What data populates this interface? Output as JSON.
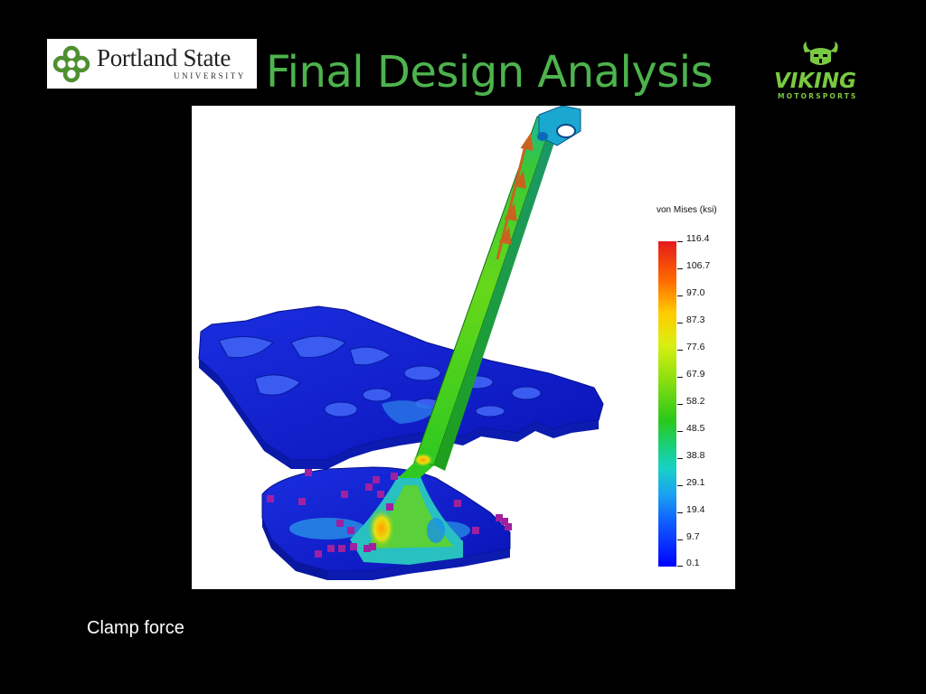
{
  "header": {
    "logo_name": "Portland State",
    "logo_subtitle": "UNIVERSITY",
    "title": "Final Design Analysis",
    "brand_word": "VIKING",
    "brand_sub": "MOTORSPORTS"
  },
  "legend": {
    "title": "von Mises (ksi)",
    "values": [
      "116.4",
      "106.7",
      "97.0",
      "87.3",
      "77.6",
      "67.9",
      "58.2",
      "48.5",
      "38.8",
      "29.1",
      "19.4",
      "9.7",
      "0.1"
    ]
  },
  "caption": "Clamp force",
  "colors": {
    "title": "#4db34d",
    "brand": "#7ac943",
    "background": "#000000"
  }
}
